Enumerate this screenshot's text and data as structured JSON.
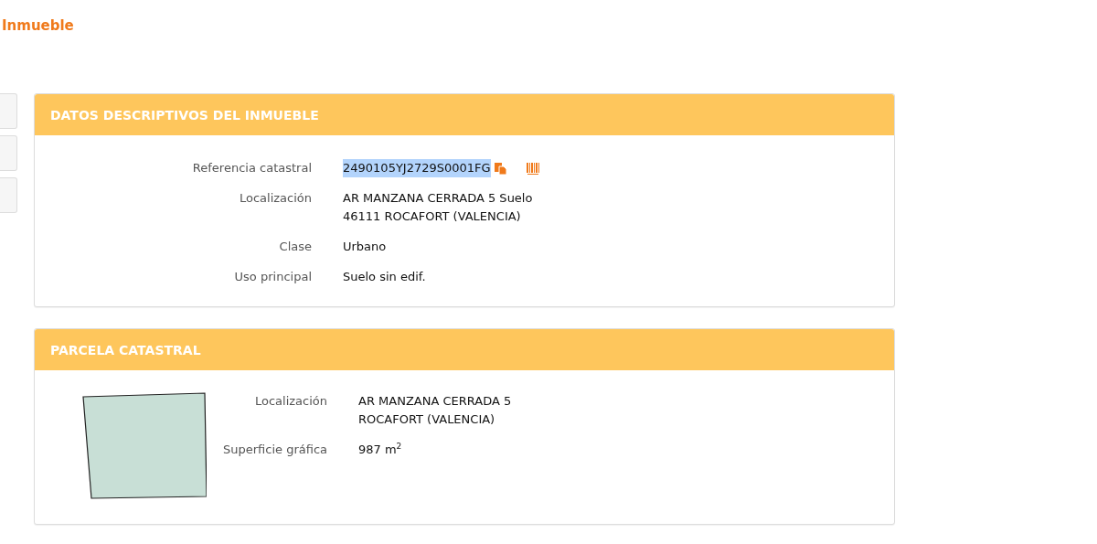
{
  "page_title": "Inmueble",
  "side_tabs": [
    {
      "selected": false
    },
    {
      "selected": false
    },
    {
      "selected": false
    }
  ],
  "panels": [
    {
      "kind": "fields",
      "title": "DATOS DESCRIPTIVOS DEL INMUEBLE",
      "rows": [
        {
          "kind": "reference",
          "label": "Referencia catastral",
          "value": "2490105YJ2729S0001FG",
          "highlighted": true
        },
        {
          "kind": "text",
          "label": "Localización",
          "value": "AR MANZANA CERRADA 5 Suelo\n46111 ROCAFORT (VALENCIA)"
        },
        {
          "kind": "text",
          "label": "Clase",
          "value": "Urbano"
        },
        {
          "kind": "text",
          "label": "Uso principal",
          "value": "Suelo sin edif."
        }
      ]
    },
    {
      "kind": "parcel",
      "title": "PARCELA CATASTRAL",
      "rows": [
        {
          "kind": "text",
          "label": "Localización",
          "value": "AR MANZANA CERRADA 5\nROCAFORT (VALENCIA)"
        },
        {
          "kind": "text",
          "label": "Superficie gráfica",
          "value": "987 m$^{2}$"
        }
      ]
    }
  ]
}
